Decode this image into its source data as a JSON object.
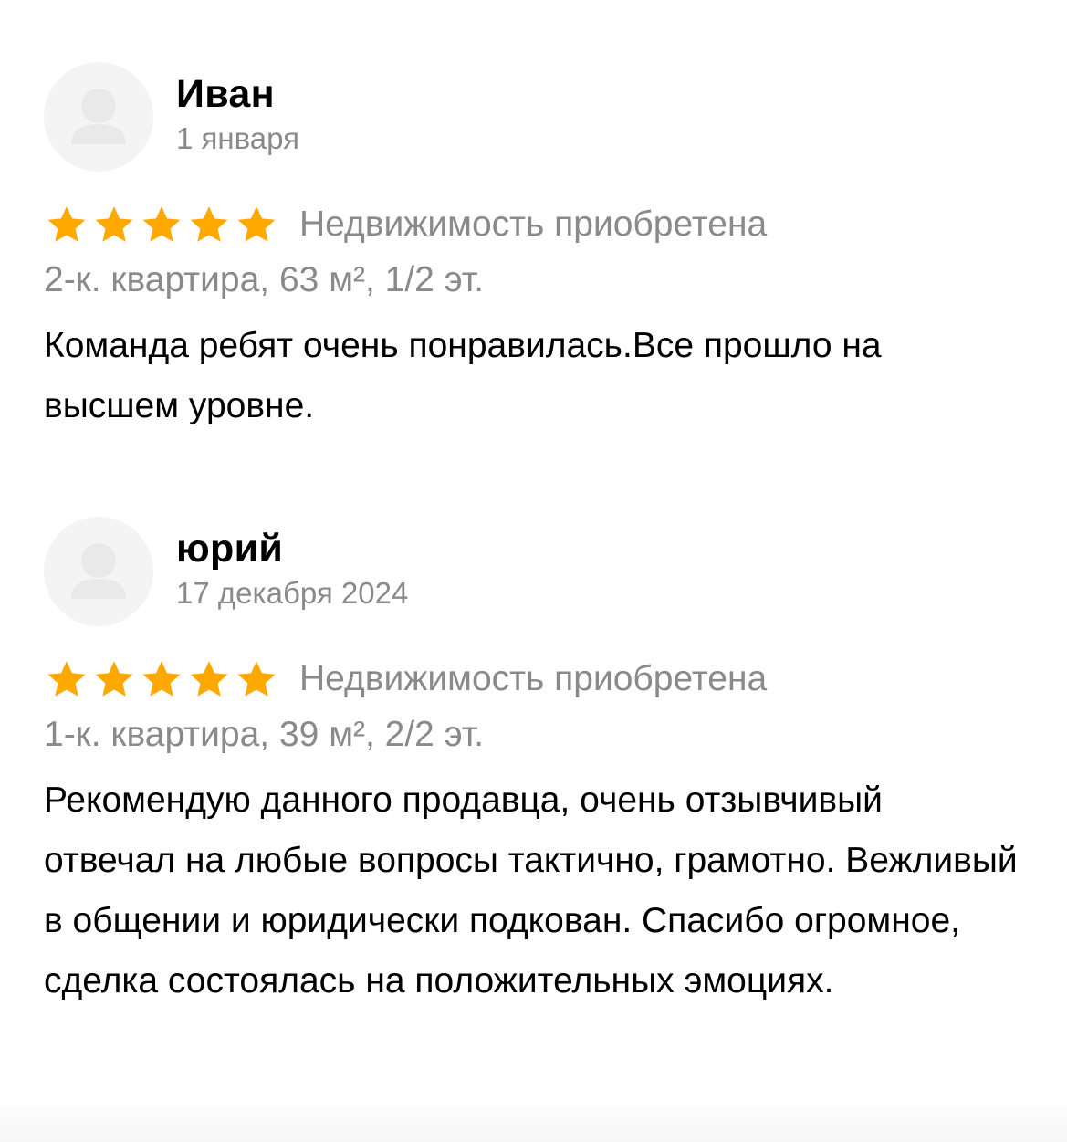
{
  "colors": {
    "star": "#ffa800",
    "muted_text": "#8a8a8a",
    "avatar_bg": "#f4f4f4"
  },
  "reviews": [
    {
      "author": "Иван",
      "date": "1 января",
      "rating": 5,
      "deal_status": "Недвижимость приобретена",
      "property": "2-к. квартира, 63 м², 1/2 эт.",
      "text": "Команда ребят очень понравилась.Все прошло на высшем уровне."
    },
    {
      "author": "юрий",
      "date": "17 декабря 2024",
      "rating": 5,
      "deal_status": "Недвижимость приобретена",
      "property": "1-к. квартира, 39 м², 2/2 эт.",
      "text": "Рекомендую данного продавца, очень отзывчивый отвечал на любые вопросы тактично, грамотно. Вежливый в общении и юридически подкован. Спасибо огромное, сделка состоялась на положительных эмоциях."
    }
  ]
}
